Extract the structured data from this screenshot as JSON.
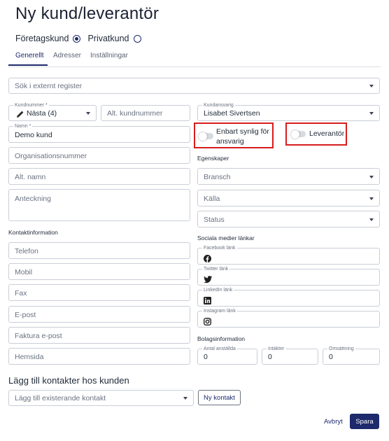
{
  "page": {
    "title": "Ny kund/leverantör"
  },
  "customer_type": {
    "company_label": "Företagskund",
    "private_label": "Privatkund",
    "selected": "company"
  },
  "tabs": [
    {
      "label": "Generellt",
      "active": true
    },
    {
      "label": "Adresser"
    },
    {
      "label": "Inställningar"
    }
  ],
  "search": {
    "placeholder": "Sök i externt register"
  },
  "customer_number": {
    "label": "Kundnummer *",
    "value": "Nästa (4)"
  },
  "alt_customer_number": {
    "placeholder": "Alt. kundnummer"
  },
  "account_manager": {
    "label": "Kundansvarig",
    "value": "Lisabet Sivertsen"
  },
  "name": {
    "label": "Namn *",
    "value": "Demo kund"
  },
  "visibility_toggle": {
    "label_line1": "Enbart synlig för",
    "label_line2": "ansvarig",
    "on": false
  },
  "supplier_toggle": {
    "label": "Leverantör",
    "on": false
  },
  "org_number": {
    "placeholder": "Organisationsnummer"
  },
  "properties": {
    "heading": "Egenskaper",
    "industry": "Bransch",
    "source": "Källa",
    "status": "Status"
  },
  "alt_name": {
    "placeholder": "Alt. namn"
  },
  "note": {
    "placeholder": "Anteckning"
  },
  "contact_info": {
    "heading": "Kontaktinformation",
    "phone": "Telefon",
    "mobile": "Mobil",
    "fax": "Fax",
    "email": "E-post",
    "invoice_email": "Faktura e-post",
    "website": "Hemsida"
  },
  "social": {
    "heading": "Sociala medier länkar",
    "facebook": "Facebook länk",
    "twitter": "Twitter länk",
    "linkedin": "LinkedIn länk",
    "instagram": "Instagram länk"
  },
  "company_info": {
    "heading": "Bolagsinformation",
    "employees_label": "Antal anställda",
    "employees_value": "0",
    "income_label": "Intäkter",
    "income_value": "0",
    "turnover_label": "Omsättning",
    "turnover_value": "0"
  },
  "contacts": {
    "heading": "Lägg till kontakter hos kunden",
    "select_placeholder": "Lägg till existerande kontakt",
    "new_button": "Ny kontakt"
  },
  "footer": {
    "cancel": "Avbryt",
    "save": "Spara"
  },
  "colors": {
    "primary": "#1d2a6b",
    "highlight": "#d61d1d",
    "border": "#c9ced6"
  }
}
